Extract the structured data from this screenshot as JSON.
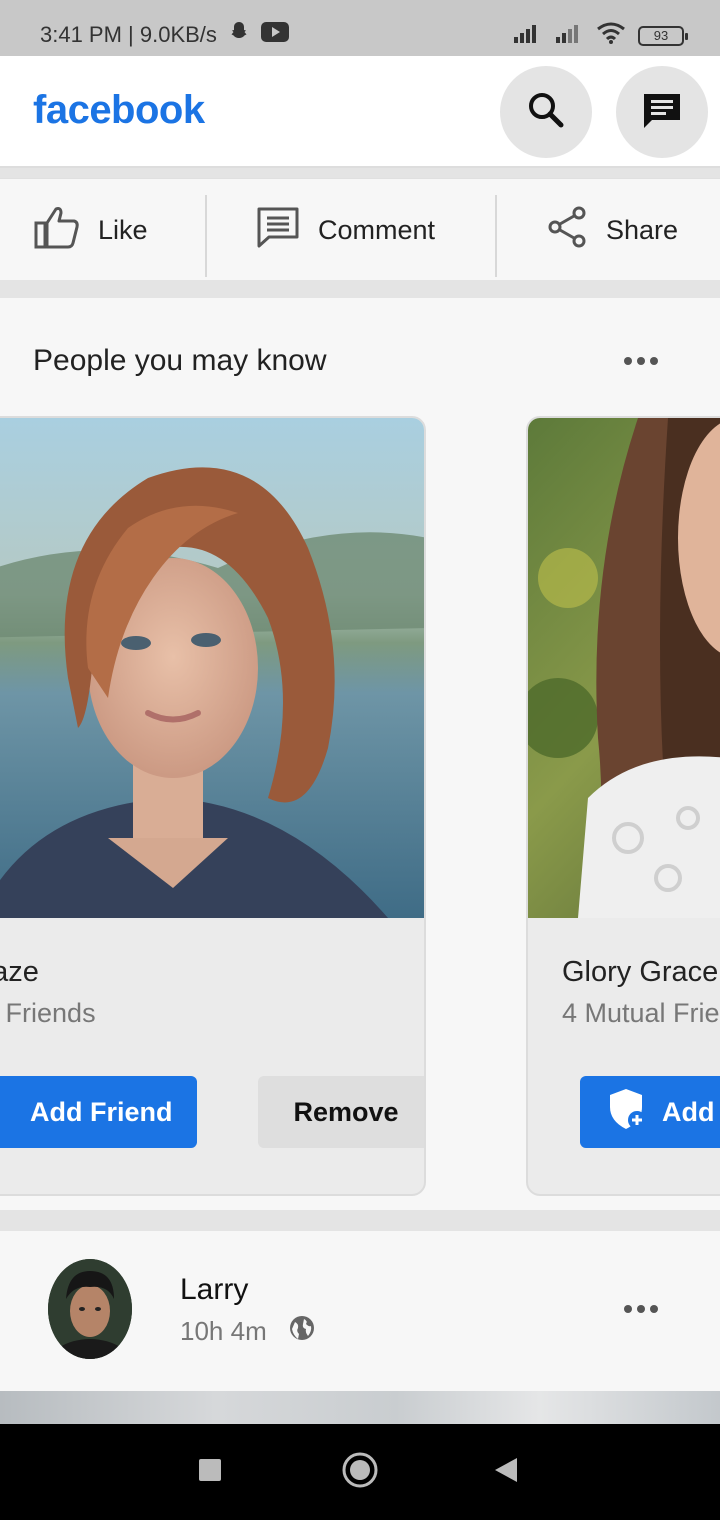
{
  "status_bar": {
    "time_speed": "3:41 PM | 9.0KB/s",
    "battery": "93"
  },
  "app_bar": {
    "logo": "facebook",
    "brand_color": "#1b74e4"
  },
  "actions": {
    "like": "Like",
    "comment": "Comment",
    "share": "Share"
  },
  "pymk": {
    "title": "People you may know",
    "cards": [
      {
        "name": "Maze",
        "mutual": "ual Friends",
        "add_label": "Add Friend",
        "remove_label": "Remove"
      },
      {
        "name": "Glory Grace",
        "mutual": "4 Mutual Frie",
        "add_label": "Add"
      }
    ]
  },
  "post": {
    "author": "Larry",
    "time": "10h 4m",
    "privacy_icon": "globe-icon"
  },
  "nav": {
    "recent": "square-icon",
    "home": "circle-icon",
    "back": "triangle-back-icon"
  }
}
